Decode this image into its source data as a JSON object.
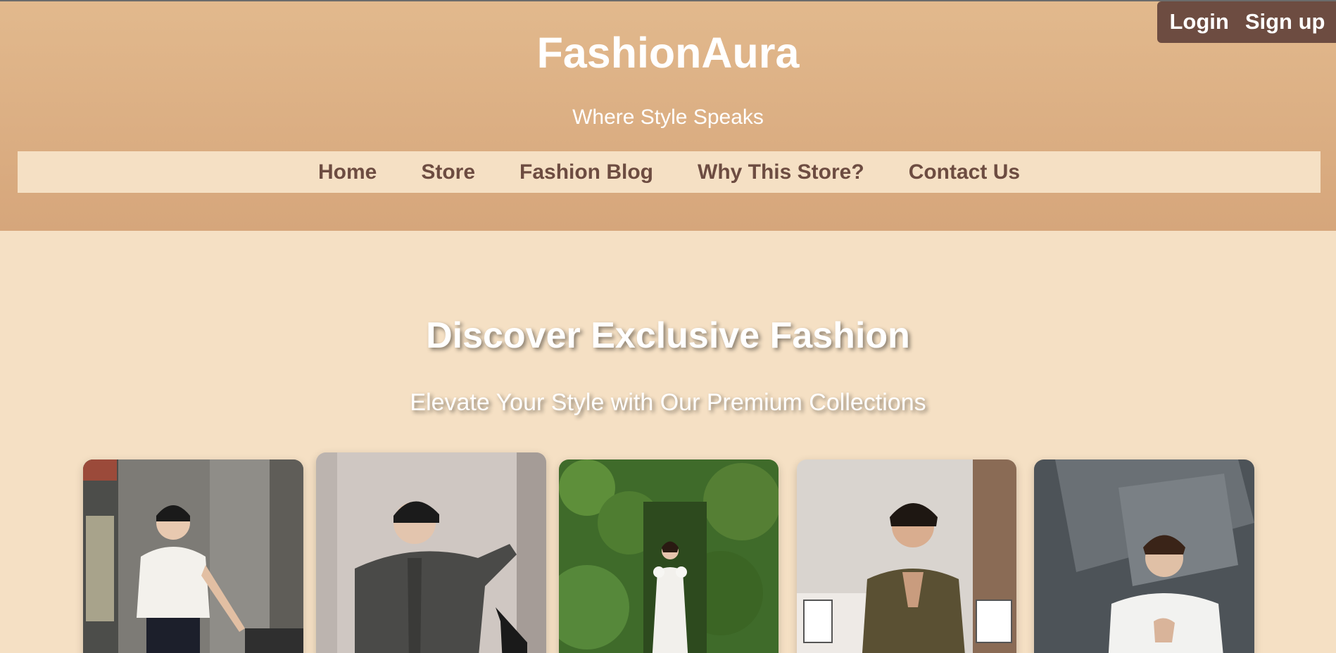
{
  "auth": {
    "login": "Login",
    "signup": "Sign up"
  },
  "brand": {
    "name": "FashionAura",
    "tagline": "Where Style Speaks"
  },
  "nav": {
    "items": [
      {
        "label": "Home"
      },
      {
        "label": "Store"
      },
      {
        "label": "Fashion Blog"
      },
      {
        "label": "Why This Store?"
      },
      {
        "label": "Contact Us"
      }
    ]
  },
  "hero": {
    "title": "Discover Exclusive Fashion",
    "subtitle": "Elevate Your Style with Our Premium Collections"
  },
  "colors": {
    "header_gradient_top": "#e2b98d",
    "header_gradient_bottom": "#d6a67b",
    "page_background": "#f5e0c4",
    "accent_brown": "#6d4c41"
  }
}
